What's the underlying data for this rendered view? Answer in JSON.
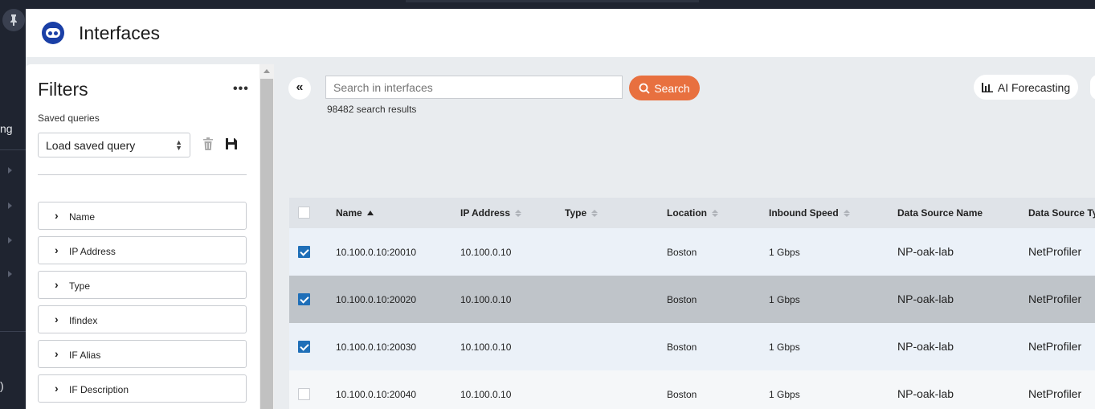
{
  "app": {
    "page_title": "Interfaces",
    "rail_fragments": [
      "ng",
      ")"
    ]
  },
  "filters": {
    "title": "Filters",
    "more_label": "•••",
    "saved_queries_label": "Saved queries",
    "saved_query_select": "Load saved query",
    "facets": [
      "Name",
      "IP Address",
      "Type",
      "Ifindex",
      "IF Alias",
      "IF Description"
    ]
  },
  "search": {
    "placeholder": "Search in interfaces",
    "button_label": "Search",
    "results_count": "98482 search results",
    "ai_forecasting_label": "AI Forecasting"
  },
  "table": {
    "columns": [
      "Name",
      "IP Address",
      "Type",
      "Location",
      "Inbound Speed",
      "Data Source Name",
      "Data Source Ty"
    ],
    "rows": [
      {
        "checked": true,
        "name": "10.100.0.10:20010",
        "ip": "10.100.0.10",
        "type": "",
        "location": "Boston",
        "speed": "1 Gbps",
        "ds_name": "NP-oak-lab",
        "ds_type": "NetProfiler"
      },
      {
        "checked": true,
        "name": "10.100.0.10:20020",
        "ip": "10.100.0.10",
        "type": "",
        "location": "Boston",
        "speed": "1 Gbps",
        "ds_name": "NP-oak-lab",
        "ds_type": "NetProfiler"
      },
      {
        "checked": true,
        "name": "10.100.0.10:20030",
        "ip": "10.100.0.10",
        "type": "",
        "location": "Boston",
        "speed": "1 Gbps",
        "ds_name": "NP-oak-lab",
        "ds_type": "NetProfiler"
      },
      {
        "checked": false,
        "name": "10.100.0.10:20040",
        "ip": "10.100.0.10",
        "type": "",
        "location": "Boston",
        "speed": "1 Gbps",
        "ds_name": "NP-oak-lab",
        "ds_type": "NetProfiler"
      }
    ]
  },
  "colors": {
    "accent": "#e8703f",
    "brand": "#1a3fa6",
    "checkbox": "#1f6fb8"
  }
}
